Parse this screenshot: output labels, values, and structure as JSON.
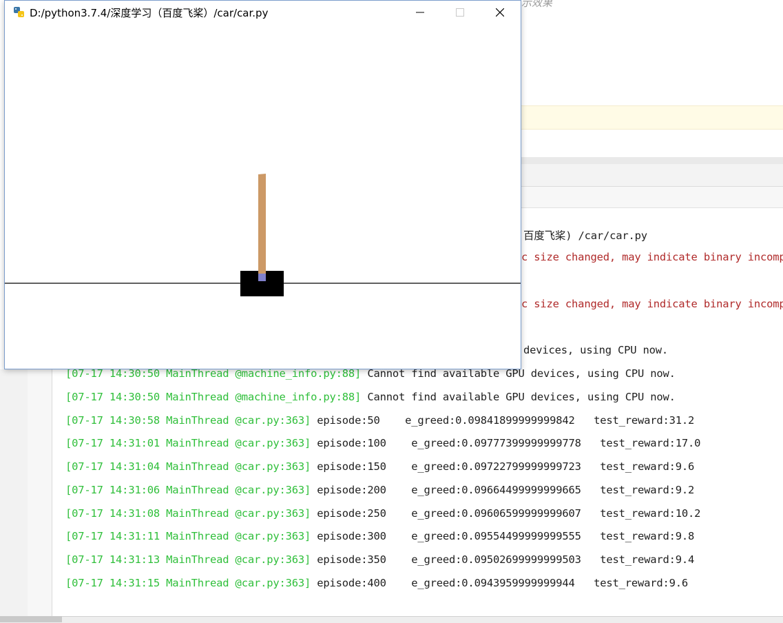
{
  "ide": {
    "top_hint": "示效果",
    "console_lines": [
      {
        "kind": "plain",
        "text": "百度飞桨) /car/car.py"
      },
      {
        "kind": "warn",
        "text": "c size changed, may indicate binary incomp"
      },
      {
        "kind": "warn",
        "text": "c size changed, may indicate binary incomp"
      },
      {
        "kind": "plain",
        "text": "devices, using CPU now."
      },
      {
        "kind": "log",
        "ts": "[07-17 14:30:50 MainThread @machine_info.py:88]",
        "msg": " Cannot find available GPU devices, using CPU now."
      },
      {
        "kind": "log",
        "ts": "[07-17 14:30:50 MainThread @machine_info.py:88]",
        "msg": " Cannot find available GPU devices, using CPU now."
      },
      {
        "kind": "log",
        "ts": "[07-17 14:30:58 MainThread @car.py:363]",
        "msg": " episode:50    e_greed:0.09841899999999842   test_reward:31.2"
      },
      {
        "kind": "log",
        "ts": "[07-17 14:31:01 MainThread @car.py:363]",
        "msg": " episode:100    e_greed:0.09777399999999778   test_reward:17.0"
      },
      {
        "kind": "log",
        "ts": "[07-17 14:31:04 MainThread @car.py:363]",
        "msg": " episode:150    e_greed:0.09722799999999723   test_reward:9.6"
      },
      {
        "kind": "log",
        "ts": "[07-17 14:31:06 MainThread @car.py:363]",
        "msg": " episode:200    e_greed:0.09664499999999665   test_reward:9.2"
      },
      {
        "kind": "log",
        "ts": "[07-17 14:31:08 MainThread @car.py:363]",
        "msg": " episode:250    e_greed:0.09606599999999607   test_reward:10.2"
      },
      {
        "kind": "log",
        "ts": "[07-17 14:31:11 MainThread @car.py:363]",
        "msg": " episode:300    e_greed:0.09554499999999555   test_reward:9.8"
      },
      {
        "kind": "log",
        "ts": "[07-17 14:31:13 MainThread @car.py:363]",
        "msg": " episode:350    e_greed:0.09502699999999503   test_reward:9.4"
      },
      {
        "kind": "log",
        "ts": "[07-17 14:31:15 MainThread @car.py:363]",
        "msg": " episode:400    e_greed:0.0943959999999944   test_reward:9.6"
      }
    ]
  },
  "window": {
    "title": "D:/python3.7.4/深度学习（百度飞桨）/car/car.py",
    "icon": "python-icon",
    "buttons": {
      "minimize": "minimize-icon",
      "maximize": "maximize-icon",
      "close": "close-icon"
    }
  },
  "scene": {
    "cart_color": "#000000",
    "pole_color": "#cc9966",
    "axle_color": "#8080cc",
    "track_color": "#000000"
  }
}
